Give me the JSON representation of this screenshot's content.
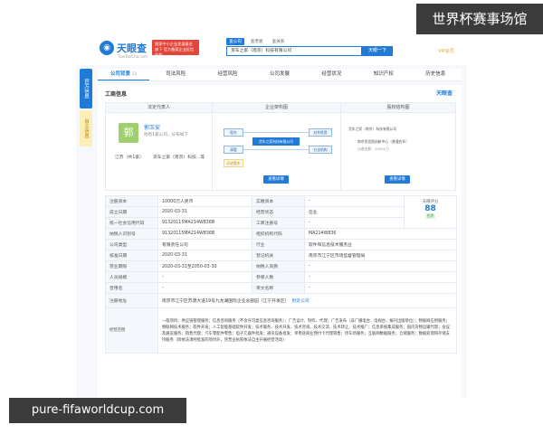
{
  "header": {
    "logo_text": "天眼查",
    "logo_sub": "TianYanCha.com",
    "promo": "国家中小企业发展基金旗下 官方备案企业征信机构",
    "search_tabs": [
      "查公司",
      "查老板",
      "查关系"
    ],
    "search_value": "货车之家（南京）科技有限公司",
    "search_button": "天眼一下",
    "vip": "VIP会员"
  },
  "side": {
    "tab_a": "官方信息",
    "tab_b": "自主信息"
  },
  "nav": [
    {
      "label": "公司背景",
      "count": "21"
    },
    {
      "label": "司法风险",
      "count": ""
    },
    {
      "label": "经营风险",
      "count": ""
    },
    {
      "label": "公司发展",
      "count": ""
    },
    {
      "label": "经营状况",
      "count": ""
    },
    {
      "label": "知识产权",
      "count": ""
    },
    {
      "label": "历史信息",
      "count": ""
    }
  ],
  "panel": {
    "title": "工商信息",
    "brand": "天眼查",
    "col_heads": [
      "法定代表人",
      "企业架构图",
      "股权结构图"
    ],
    "person": {
      "avatar": "郭",
      "name": "郭玉安",
      "sub_prefix": "他有",
      "sub_count": "1",
      "sub_suffix": "家公司，分布如下",
      "loc_1": "江苏（共1家）",
      "loc_2": "货车之家（南京）科技...等"
    },
    "structure": {
      "left_1": "股东",
      "left_2": "高管",
      "center": "货车之家科技有限公司",
      "right_1": "对外投资",
      "right_2": "分支机构",
      "bottom": "历史股东"
    },
    "equity": {
      "row_1": "货车之家（南京）科技有限公司",
      "row_2": "南京恒信翔创新中心（普通合伙）",
      "row_3": "认缴金额：10000万"
    },
    "detail_btn_1": "查看详情",
    "detail_btn_2": "查看详情"
  },
  "table": {
    "rows": [
      [
        "注册资本",
        "10000万人民币",
        "实缴资本",
        "-"
      ],
      [
        "成立日期",
        "2020-03-31",
        "经营状态",
        "在业"
      ],
      [
        "统一社会信用代码",
        "91320115MA214W836B",
        "工商注册号",
        "-"
      ],
      [
        "纳税人识别号",
        "91320115MA214W836B",
        "组织机构代码",
        "MA214W836"
      ],
      [
        "公司类型",
        "有限责任公司",
        "行业",
        "软件和信息技术服务业"
      ],
      [
        "核准日期",
        "2020-03-31",
        "登记机关",
        "南京市江宁区市场监督管理局"
      ],
      [
        "营业期限",
        "2020-03-31至2050-03-30",
        "纳税人资质",
        "-"
      ],
      [
        "人员规模",
        "-",
        "参保人数",
        "-"
      ],
      [
        "曾用名",
        "-",
        "英文名称",
        "-"
      ]
    ],
    "score_label": "天眼评分",
    "score_value": "88",
    "score_tag": "优秀",
    "address_label": "注册地址",
    "address_value": "南京市江宁区苏源大道19号九龙湖国际企业总部园（江宁开发区）",
    "address_link": "附近公司",
    "scope_label": "经营范围",
    "scope_value": "一般项目：供应链管理服务；信息咨询服务（不含许可类信息咨询服务）；广告设计、制作、代理；广告发布（非广播电台、电视台、报刊出版单位）；物联网应用服务；物联网技术服务；软件开发；人工智能基础软件开发；技术服务、技术开发、技术咨询、技术交流、技术转让、技术推广；信息系统集成服务；国内货物运输代理；会议及展览服务；销售代理；汽车零配件零售；电子元器件批发；通讯设备批发；单用途商业预付卡代理销售；停车场服务；互联网数据服务；仓储服务；数据处理和存储支持服务（除依法须经批准的项目外，凭营业执照依法自主开展经营活动）"
  },
  "overlay": {
    "top_watermark": "世界杯赛事场馆",
    "bottom_watermark": "pure-fifaworldcup.com"
  },
  "colors": {
    "accent": "#1f7ad8",
    "promo": "#e2463a",
    "avatar": "#9fcf6f"
  }
}
